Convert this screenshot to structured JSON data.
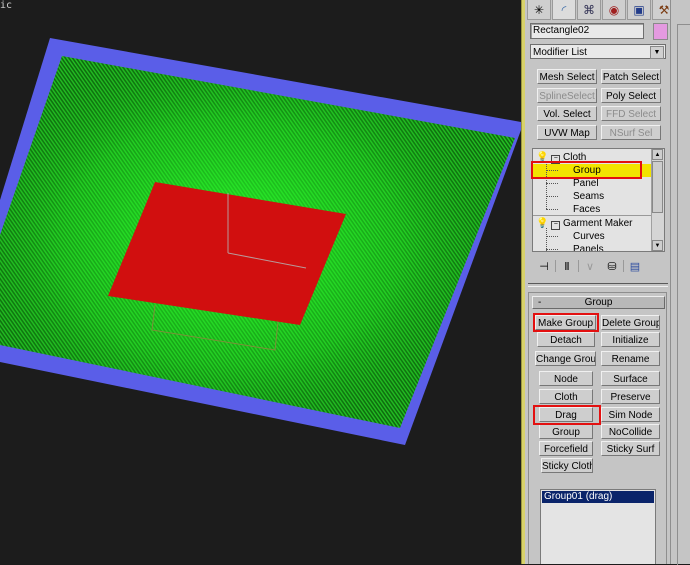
{
  "viewport": {
    "label": "ic",
    "colors": {
      "background": "#1c1c1c",
      "border": "#5a5ee8",
      "cloth": "#1fae1f",
      "cloth_bright": "#22f022",
      "patch": "#d10f0f"
    }
  },
  "command_panel": {
    "tabs": [
      {
        "name": "create",
        "icon": "create-icon"
      },
      {
        "name": "modify",
        "icon": "modify-icon"
      },
      {
        "name": "hierarchy",
        "icon": "hierarchy-icon"
      },
      {
        "name": "motion",
        "icon": "motion-icon"
      },
      {
        "name": "display",
        "icon": "display-icon"
      },
      {
        "name": "utilities",
        "icon": "utilities-icon"
      }
    ],
    "object_name": "Rectangle02",
    "object_color": "#e49ae0",
    "modifier_list": "Modifier List",
    "modifier_buttons": [
      {
        "label": "Mesh Select",
        "enabled": true
      },
      {
        "label": "Patch Select",
        "enabled": true
      },
      {
        "label": "SplineSelect",
        "enabled": false
      },
      {
        "label": "Poly Select",
        "enabled": true
      },
      {
        "label": "Vol. Select",
        "enabled": true
      },
      {
        "label": "FFD Select",
        "enabled": false
      },
      {
        "label": "UVW Map",
        "enabled": true
      },
      {
        "label": "NSurf Sel",
        "enabled": false
      }
    ],
    "stack": {
      "items": [
        {
          "label": "Cloth",
          "level": 0
        },
        {
          "label": "Group",
          "level": 1,
          "selected": true
        },
        {
          "label": "Panel",
          "level": 1
        },
        {
          "label": "Seams",
          "level": 1
        },
        {
          "label": "Faces",
          "level": 1
        },
        {
          "label": "Garment Maker",
          "level": 0
        },
        {
          "label": "Curves",
          "level": 1
        },
        {
          "label": "Panels",
          "level": 1
        }
      ],
      "selected_color": "#f2e400"
    },
    "stack_tools": [
      "pin-stack-icon",
      "show-end-result-icon",
      "make-unique-icon",
      "remove-modifier-icon",
      "configure-modifier-sets-icon"
    ],
    "group_rollout": {
      "title": "Group",
      "collapse": "-",
      "buttons": [
        "Make Group",
        "Delete Group",
        "Detach",
        "Initialize",
        "Change Group",
        "Rename",
        "Node",
        "Surface",
        "Cloth",
        "Preserve",
        "Drag",
        "Sim Node",
        "Group",
        "NoCollide",
        "Forcefield",
        "Sticky Surf",
        "Sticky Cloth"
      ],
      "highlighted": [
        "Make Group",
        "Drag"
      ],
      "group_list": [
        "Group01 (drag)"
      ],
      "highlight_color": "#e31010"
    }
  }
}
